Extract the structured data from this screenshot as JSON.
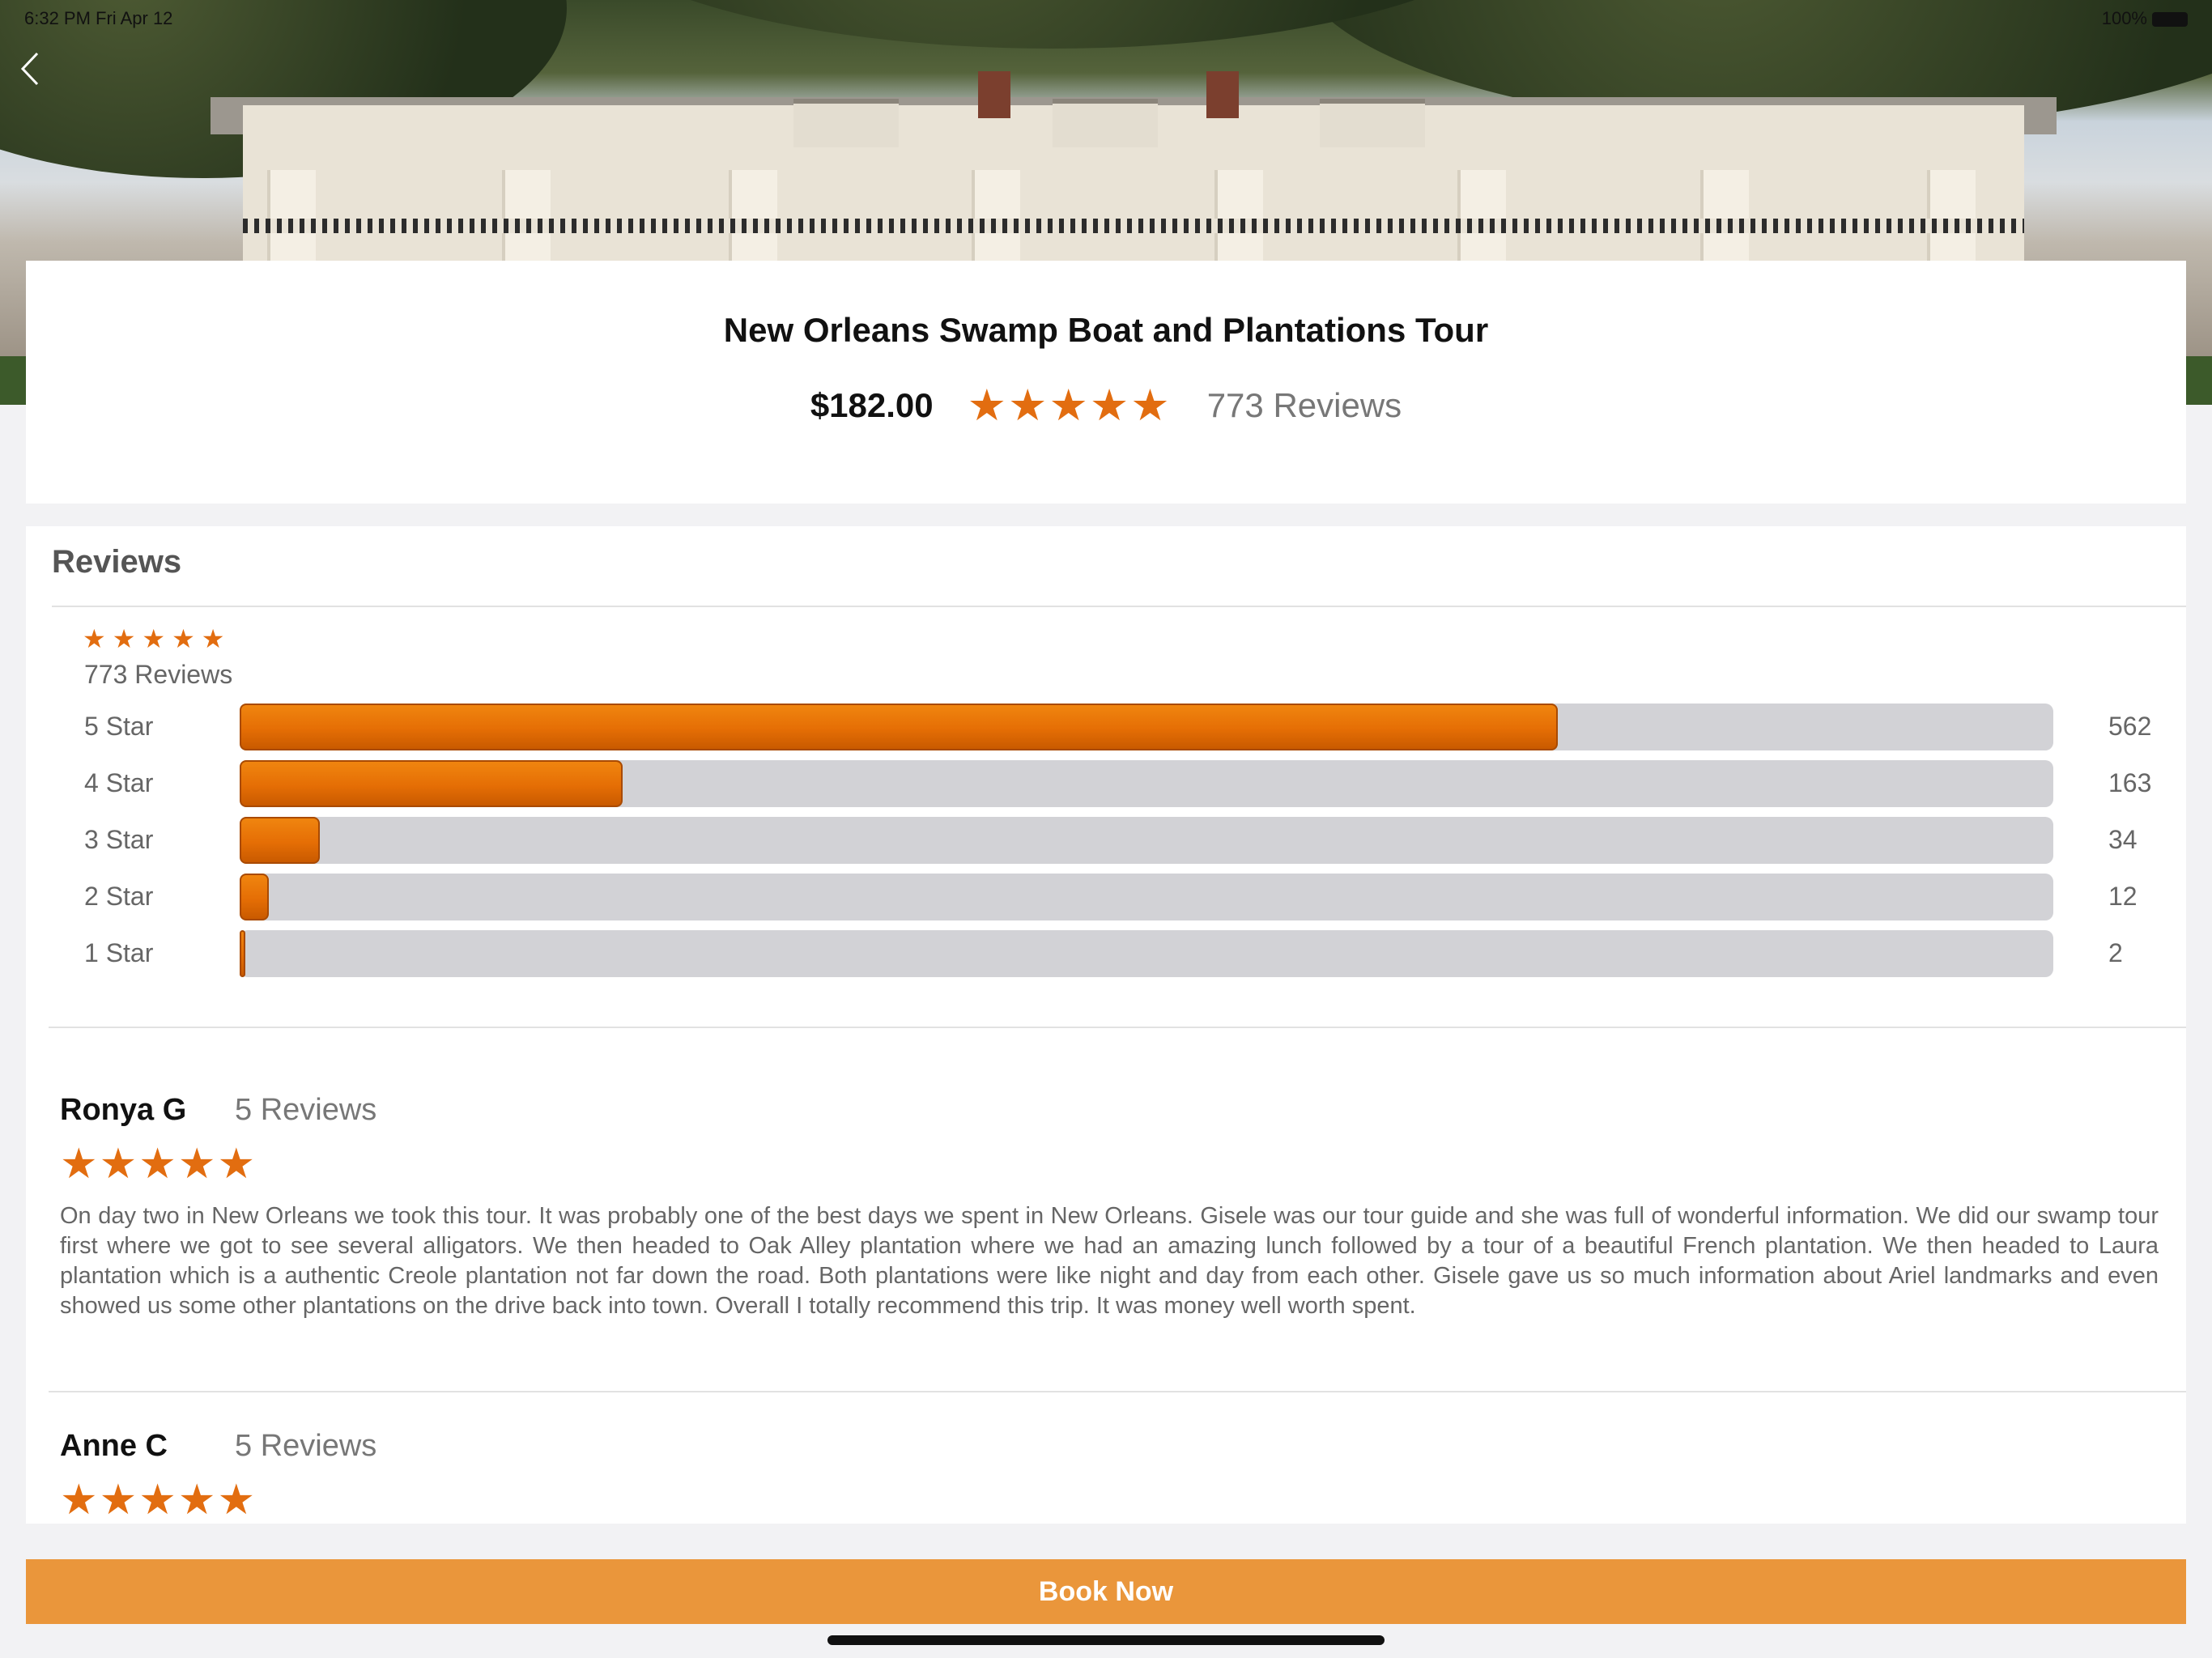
{
  "status": {
    "left": "6:32 PM  Fri Apr 12",
    "right": "100%"
  },
  "tour": {
    "title": "New Orleans Swamp Boat and Plantations Tour",
    "price": "$182.00",
    "stars": "★★★★★",
    "reviews_label": "773 Reviews"
  },
  "reviews_section": {
    "title": "Reviews",
    "summary_stars": "★★★★★",
    "summary_count": "773 Reviews",
    "breakdown": [
      {
        "label": "5 Star",
        "count": "562",
        "fraction": 0.727
      },
      {
        "label": "4 Star",
        "count": "163",
        "fraction": 0.211
      },
      {
        "label": "3 Star",
        "count": "34",
        "fraction": 0.044
      },
      {
        "label": "2 Star",
        "count": "12",
        "fraction": 0.016
      },
      {
        "label": "1 Star",
        "count": "2",
        "fraction": 0.003
      }
    ],
    "items": [
      {
        "name": "Ronya G",
        "count": "5 Reviews",
        "stars": "★★★★★",
        "text": "On day two in New Orleans we took this tour. It was probably one of the best days we spent in New Orleans. Gisele was our tour guide and she was full of wonderful information. We did our swamp tour first where we got to see several alligators. We then headed to Oak Alley plantation where we had an amazing lunch followed by a tour of a beautiful French plantation. We then headed to Laura plantation which is a authentic Creole plantation not far down the road. Both plantations were like night and day from each other. Gisele gave us so much information about Ariel landmarks and even showed us some other plantations on the drive back into town. Overall I totally recommend this trip. It was money well worth spent."
      },
      {
        "name": "Anne C",
        "count": "5 Reviews",
        "stars": "★★★★★",
        "text": ""
      }
    ]
  },
  "book_button": "Book Now",
  "colors": {
    "accent": "#e26d10",
    "book": "#ea963b",
    "track": "#d2d2d6"
  },
  "icons": {
    "back": "chevron-left-icon"
  }
}
